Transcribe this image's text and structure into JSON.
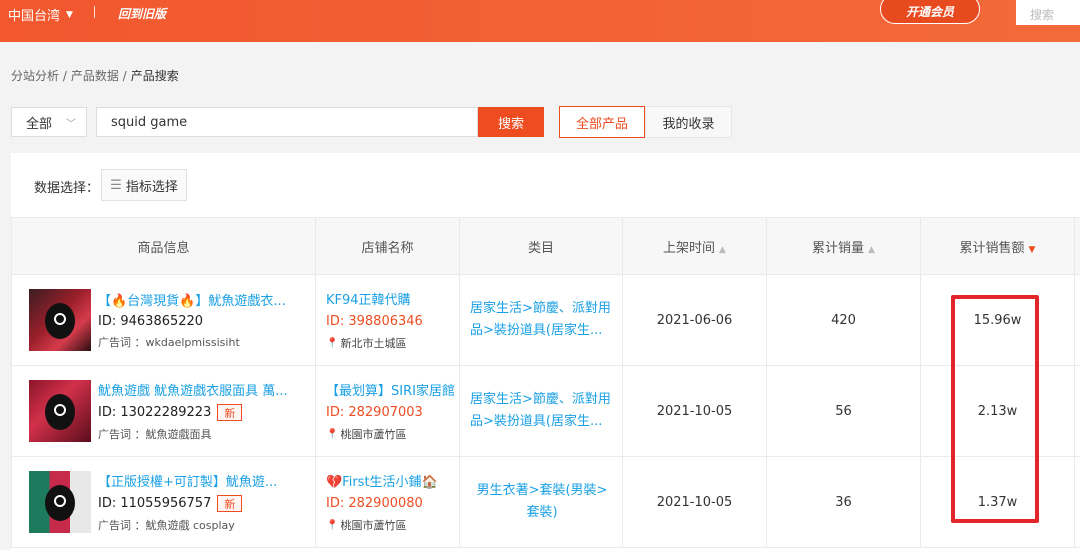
{
  "topbar": {
    "region": "中国台湾",
    "old_version": "回到旧版",
    "vip_button": "开通会员",
    "search_placeholder": "搜索"
  },
  "breadcrumb": [
    "分站分析 /",
    "产品数据 /",
    "产品搜索"
  ],
  "search": {
    "scope": "全部",
    "keyword": "squid game",
    "button": "搜索"
  },
  "tabs": {
    "all_products": "全部产品",
    "my_favorites": "我的收录"
  },
  "data_select": {
    "label": "数据选择：",
    "metric_button": "指标选择"
  },
  "table": {
    "headers": [
      "商品信息",
      "店铺名称",
      "类目",
      "上架时间",
      "累计销量",
      "累计销售额"
    ],
    "rows": [
      {
        "title": "【🔥台灣現貨🔥】魷魚遊戲衣...",
        "id": "ID: 9463865220",
        "is_new": false,
        "ad_words": "广告词 ：wkdaelpmissisiht",
        "shop_name": "KF94正韓代購",
        "shop_id": "ID: 398806346",
        "shop_location": "新北市土城區",
        "category": "居家生活>節慶、派對用品>裝扮道具(居家生...",
        "listed_date": "2021-06-06",
        "sales": "420",
        "revenue": "15.96w"
      },
      {
        "title": "魷魚遊戲 魷魚遊戲衣服面具 萬...",
        "id": "ID: 13022289223",
        "is_new": true,
        "ad_words": "广告词 ：魷魚遊戲面具",
        "shop_name": "【最划算】SIRI家居館",
        "shop_id": "ID: 282907003",
        "shop_location": "桃園市蘆竹區",
        "category": "居家生活>節慶、派對用品>裝扮道具(居家生...",
        "listed_date": "2021-10-05",
        "sales": "56",
        "revenue": "2.13w"
      },
      {
        "title": "【正版授權+可訂製】魷魚遊...",
        "id": "ID: 11055956757",
        "is_new": true,
        "ad_words": "广告词 ：魷魚遊戲 cosplay",
        "shop_name": "💔First生活小鋪🏠",
        "shop_id": "ID: 282900080",
        "shop_location": "桃園市蘆竹區",
        "category": "男生衣著>套裝(男裝> 套裝)",
        "listed_date": "2021-10-05",
        "sales": "36",
        "revenue": "1.37w"
      }
    ],
    "new_tag": "新"
  },
  "colors": {
    "brand": "#ee4d22",
    "link": "#1aa0e4",
    "highlight": "#e3262a"
  }
}
